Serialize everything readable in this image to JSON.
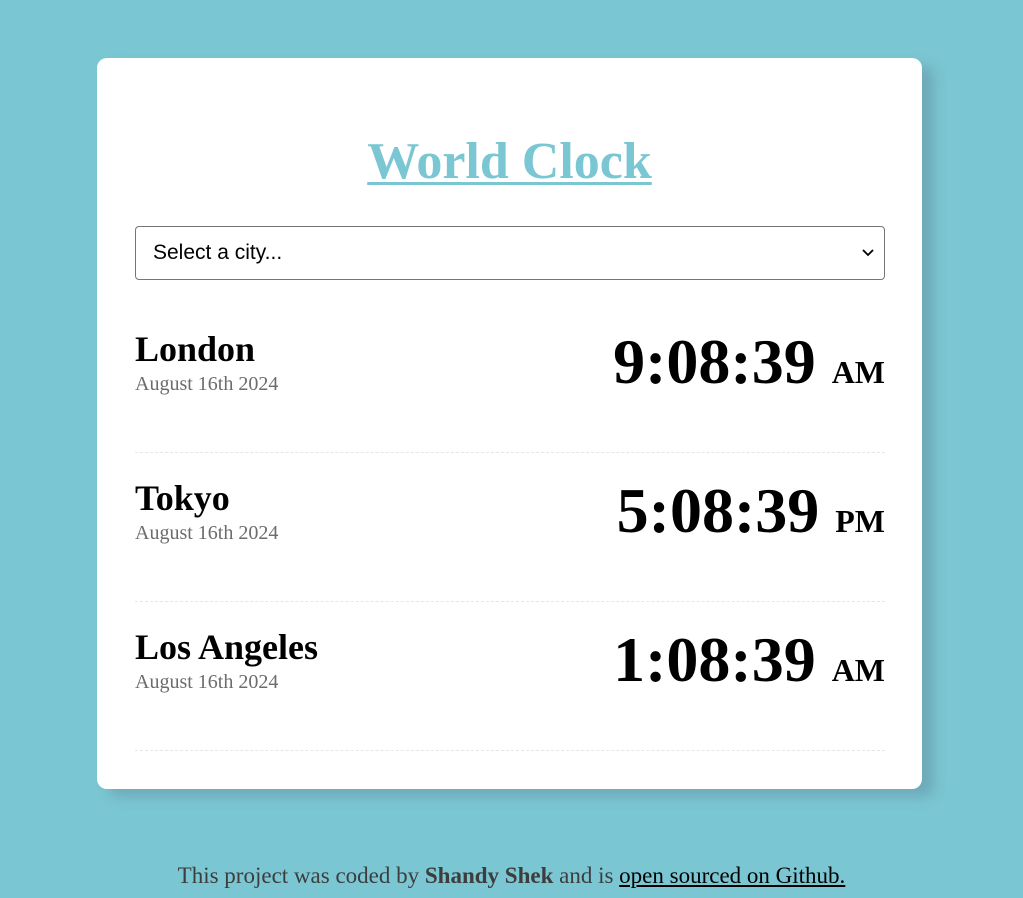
{
  "page": {
    "background": "#7bc6d3",
    "title": "World Clock",
    "title_color": "#7bc6d3"
  },
  "city_select": {
    "selected": "Select a city...",
    "icon": "chevron-down-icon"
  },
  "cities": [
    {
      "name": "London",
      "date": "August 16th 2024",
      "time": "9:08:39",
      "ampm": "AM"
    },
    {
      "name": "Tokyo",
      "date": "August 16th 2024",
      "time": "5:08:39",
      "ampm": "PM"
    },
    {
      "name": "Los Angeles",
      "date": "August 16th 2024",
      "time": "1:08:39",
      "ampm": "AM"
    }
  ],
  "footer": {
    "prefix": "This project was coded by",
    "author": "Shandy Shek",
    "middle": "and is",
    "link_text": "open sourced on Github."
  }
}
